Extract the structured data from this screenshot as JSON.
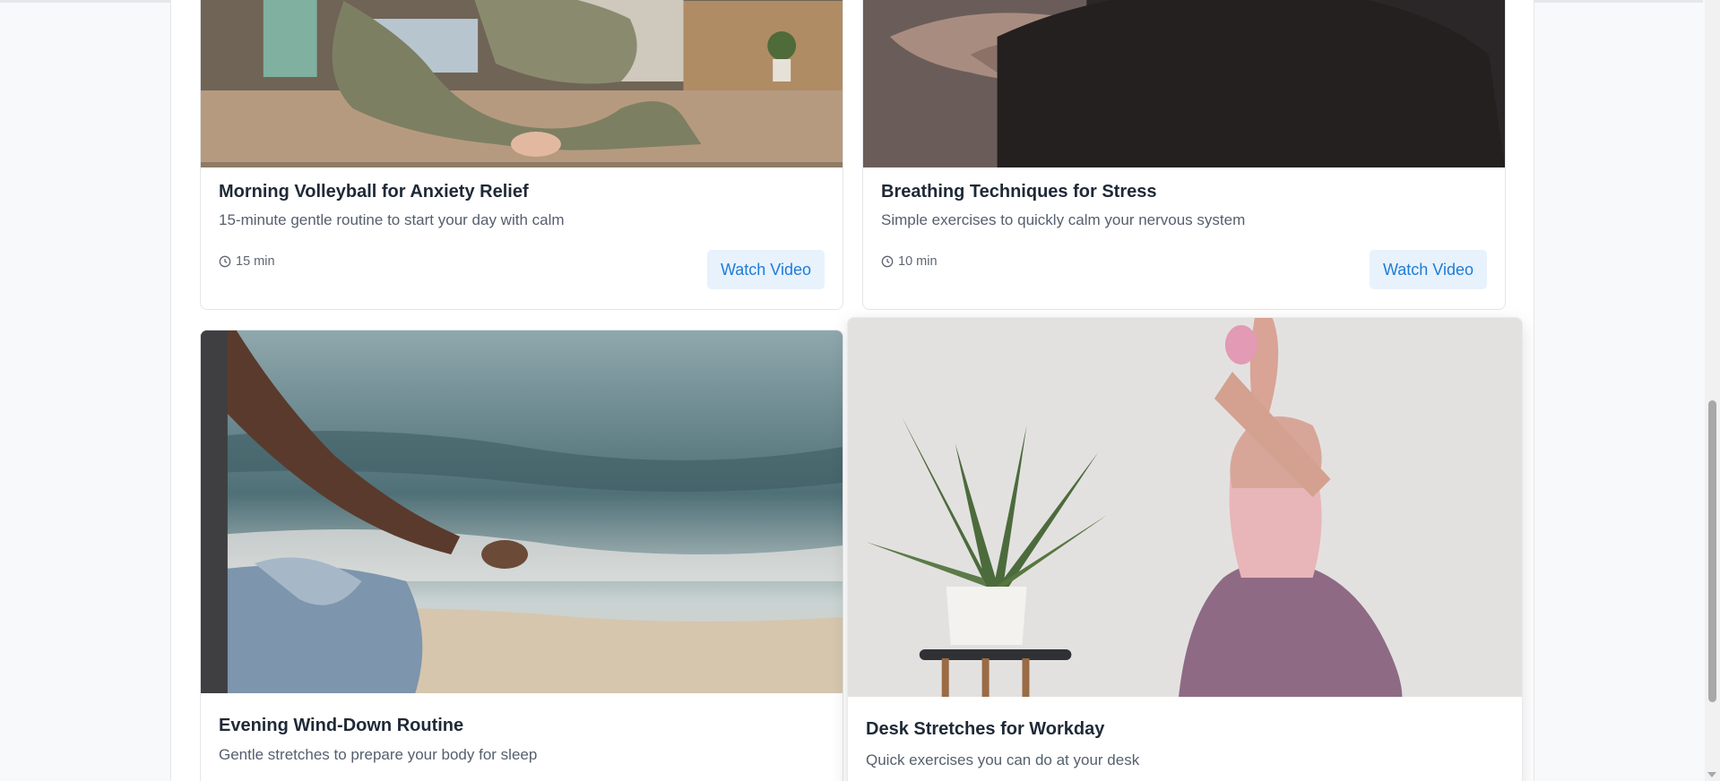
{
  "videos": [
    {
      "title": "Morning Volleyball for Anxiety Relief",
      "description": "15-minute gentle routine to start your day with calm",
      "duration": "15 min",
      "button_label": "Watch Video",
      "thumbnail_icon": "yoga-pose-image"
    },
    {
      "title": "Breathing Techniques for Stress",
      "description": "Simple exercises to quickly calm your nervous system",
      "duration": "10 min",
      "button_label": "Watch Video",
      "thumbnail_icon": "meditation-hands-image"
    },
    {
      "title": "Evening Wind-Down Routine",
      "description": "Gentle stretches to prepare your body for sleep",
      "thumbnail_icon": "beach-meditation-image"
    },
    {
      "title": "Desk Stretches for Workday",
      "description": "Quick exercises you can do at your desk",
      "thumbnail_icon": "yoga-plant-image"
    }
  ],
  "colors": {
    "accent": "#1f7cd6",
    "button_bg": "#e7f2fd",
    "page_bg": "#f8f9fa"
  },
  "icons": {
    "clock": "clock-icon"
  }
}
